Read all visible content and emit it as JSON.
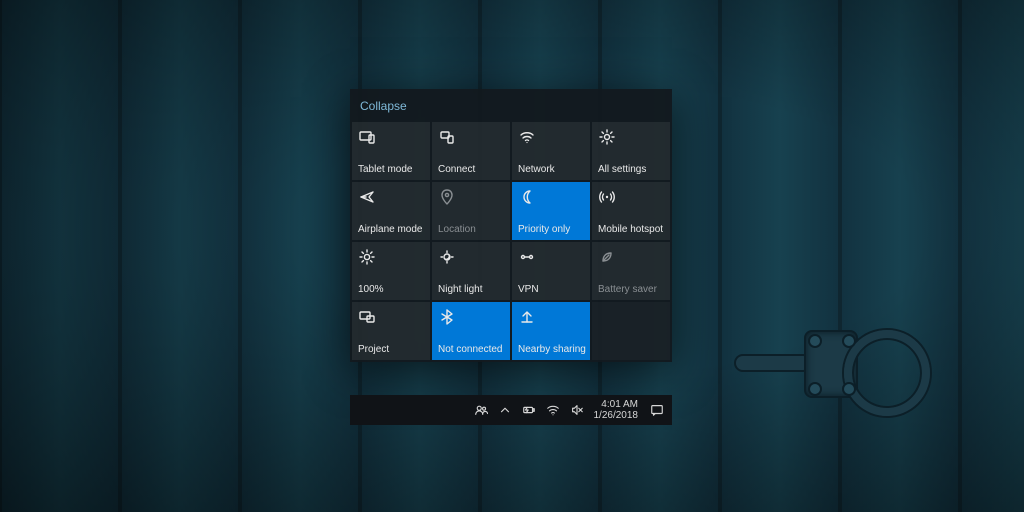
{
  "header": {
    "collapse_label": "Collapse"
  },
  "tiles": [
    {
      "id": "tablet-mode",
      "label": "Tablet mode",
      "icon": "tablet-icon",
      "state": "normal"
    },
    {
      "id": "connect",
      "label": "Connect",
      "icon": "connect-icon",
      "state": "normal"
    },
    {
      "id": "network",
      "label": "Network",
      "icon": "wifi-icon",
      "state": "normal"
    },
    {
      "id": "all-settings",
      "label": "All settings",
      "icon": "gear-icon",
      "state": "normal"
    },
    {
      "id": "airplane-mode",
      "label": "Airplane mode",
      "icon": "airplane-icon",
      "state": "normal"
    },
    {
      "id": "location",
      "label": "Location",
      "icon": "location-icon",
      "state": "disabled"
    },
    {
      "id": "priority-only",
      "label": "Priority only",
      "icon": "moon-icon",
      "state": "active"
    },
    {
      "id": "mobile-hotspot",
      "label": "Mobile hotspot",
      "icon": "hotspot-icon",
      "state": "normal"
    },
    {
      "id": "brightness",
      "label": "100%",
      "icon": "brightness-icon",
      "state": "normal"
    },
    {
      "id": "night-light",
      "label": "Night light",
      "icon": "night-light-icon",
      "state": "normal"
    },
    {
      "id": "vpn",
      "label": "VPN",
      "icon": "vpn-icon",
      "state": "normal"
    },
    {
      "id": "battery-saver",
      "label": "Battery saver",
      "icon": "leaf-icon",
      "state": "disabled"
    },
    {
      "id": "project",
      "label": "Project",
      "icon": "project-icon",
      "state": "normal"
    },
    {
      "id": "bluetooth",
      "label": "Not connected",
      "icon": "bluetooth-icon",
      "state": "active"
    },
    {
      "id": "nearby-sharing",
      "label": "Nearby sharing",
      "icon": "share-icon",
      "state": "active"
    },
    {
      "id": "empty",
      "label": "",
      "icon": "",
      "state": "empty"
    }
  ],
  "taskbar": {
    "time": "4:01 AM",
    "date": "1/26/2018",
    "tray_icons": [
      "people-icon",
      "chevron-up-icon",
      "battery-icon",
      "wifi-icon",
      "volume-mute-icon"
    ],
    "action_center_icon": "notification-icon"
  },
  "colors": {
    "accent": "#0078d7",
    "link": "#7fb9d8",
    "panel_bg": "rgba(18,24,30,0.94)"
  }
}
